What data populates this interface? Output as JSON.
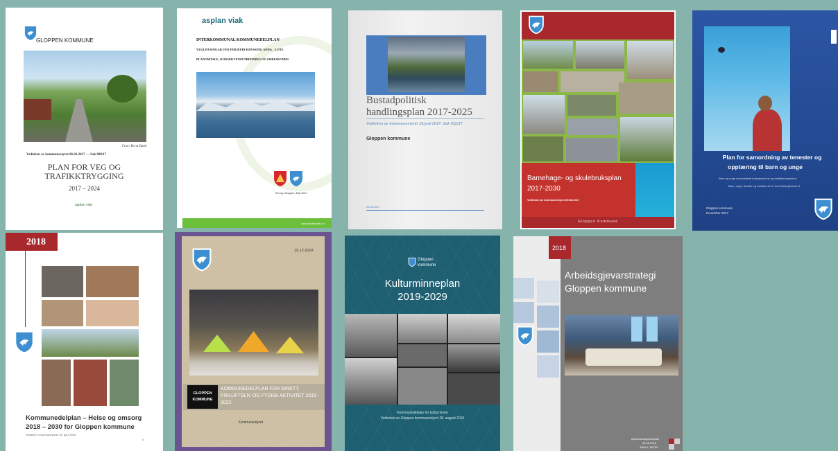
{
  "background_color": "#86b3ab",
  "covers": {
    "veg": {
      "org": "GLOPPEN KOMMUNE",
      "photo_credit": "Foto: Bernt Bædt",
      "adopted": "Vedteken av kommunestyret 06.03.2017 — Sak 008/17",
      "title_line1": "PLAN FOR VEG OG",
      "title_line2": "TRAFIKKTRYGGING",
      "years": "2017 – 2024",
      "publisher": "asplan viak"
    },
    "kommunedelplan": {
      "logo": "asplan viak",
      "heading": "INTERKOMMUNAL KOMMUNEDELPLAN",
      "sub1": "VEGLØYSINGAR VED FERJEFRI KRYSSING ANDA – LOTE",
      "sub2": "PLANOMTALE, KONSEKVENSUTREDNING OG FØRESEGNER",
      "date": "Eid og Gloppen, Mai 2017",
      "url": "www.asplanviak.no"
    },
    "bustad": {
      "title_line1": "Bustadpolitisk",
      "title_line2": "handlingsplan 2017-2025",
      "adopted": "Vedteken av kommunestyret 19.juni 2017- Sak 032/17",
      "org": "Gloppen kommune",
      "date": "20.06.2017"
    },
    "barnehage": {
      "title_line1": "Barnehage- og skulebruksplan",
      "title_line2": "2017-2030",
      "adopted": "Vedteken av kommunestyret 25.08.2017",
      "footer": "Gloppen Kommune"
    },
    "samordning": {
      "title_line1": "Plan for samordning av tenester og",
      "title_line2": "opplæring til barn og unge",
      "bullet1": "Barn og unge med nedsett funksjonsevne og habiliteringsbehov",
      "bullet2": "Barn, unge, familier og familiar der er truet helsetjeneste d",
      "org": "Gloppen kommune",
      "date": "November 2017"
    },
    "helse": {
      "year": "2018",
      "title_line1": "Kommunedelplan – Helse og omsorg",
      "title_line2": "2018 – 2030 for Gloppen kommune",
      "adopted": "Vedteken i kommunestyret 25. april 2018",
      "page": "0"
    },
    "idrett": {
      "date": "19.12.2018",
      "logo_line1": "GLOPPEN",
      "logo_line2": "KOMMUNE",
      "title": "KOMMUNEDELPLAN FOR IDRETT, FRILUFTSLIV OG FYSISK AKTIVITET 2019 - 2022",
      "footer": "Kommunestyret"
    },
    "kultur": {
      "logo_line1": "Gloppen",
      "logo_line2": "kommune",
      "title_line1": "Kulturminneplan",
      "title_line2": "2019-2029",
      "caption1": "Kommunedelplan for kulturminne",
      "caption2": "Vedteken av Gloppen kommunestyret 28. august 2019"
    },
    "arbeid": {
      "year": "2018",
      "title_line1": "Arbeidsgjevarstrategi",
      "title_line2": "Gloppen kommune",
      "footer1": "Administrasjonsutvalet",
      "footer2": "26.05.2018",
      "footer3": "ARKIV: 18/799"
    }
  }
}
